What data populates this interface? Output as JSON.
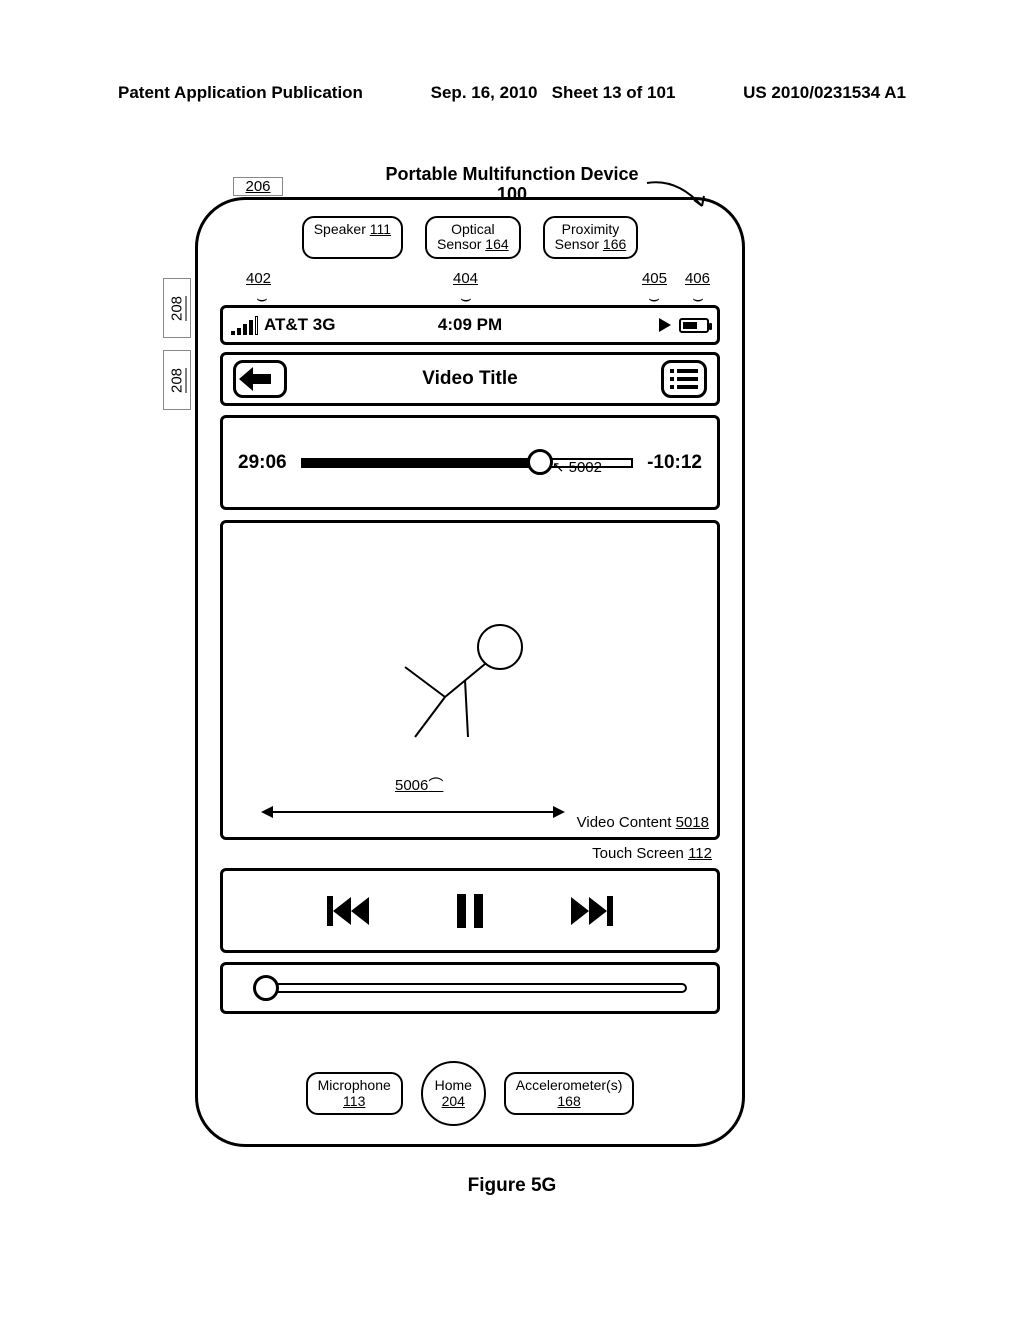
{
  "header": {
    "left": "Patent Application Publication",
    "date": "Sep. 16, 2010",
    "sheet": "Sheet 13 of 101",
    "pubno": "US 2010/0231534 A1"
  },
  "device": {
    "title": "Portable Multifunction Device",
    "number": "100"
  },
  "topComponents": {
    "speaker": {
      "label": "Speaker",
      "ref": "111"
    },
    "optical": {
      "label1": "Optical",
      "label2": "Sensor",
      "ref": "164"
    },
    "proximity": {
      "label1": "Proximity",
      "label2": "Sensor",
      "ref": "166"
    }
  },
  "sideRefs": {
    "r206": "206",
    "r208a": "208",
    "r208b": "208"
  },
  "annotations": {
    "a402": "402",
    "a404": "404",
    "a405": "405",
    "a406": "406"
  },
  "statusBar": {
    "carrier": "AT&T 3G",
    "time": "4:09 PM"
  },
  "navBar": {
    "title": "Video Title"
  },
  "scrubber": {
    "elapsed": "29:06",
    "remaining": "-10:12",
    "knobRef": "5002"
  },
  "video": {
    "gestureRef": "5006",
    "contentLabel": "Video Content",
    "contentRef": "5018"
  },
  "touchScreen": {
    "label": "Touch Screen",
    "ref": "112"
  },
  "bottomComponents": {
    "mic": {
      "label": "Microphone",
      "ref": "113"
    },
    "home": {
      "label": "Home",
      "ref": "204"
    },
    "accel": {
      "label": "Accelerometer(s)",
      "ref": "168"
    }
  },
  "figureCaption": "Figure 5G"
}
